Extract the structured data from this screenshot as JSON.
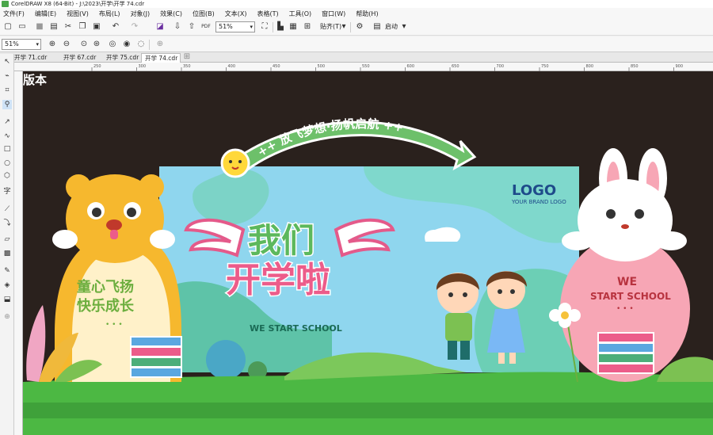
{
  "window": {
    "title": "CorelDRAW X8 (64-Bit) - J:\\2023\\开学\\开学 74.cdr"
  },
  "menu": [
    "文件(F)",
    "编辑(E)",
    "视图(V)",
    "布局(L)",
    "对象(J)",
    "效果(C)",
    "位图(B)",
    "文本(X)",
    "表格(T)",
    "工具(O)",
    "窗口(W)",
    "帮助(H)"
  ],
  "toolbar": {
    "zoom_value": "51%",
    "snap_label": "贴齐(T)",
    "launch_label": "启动",
    "pdf_label": "PDF"
  },
  "propbar": {
    "zoom_value": "51%"
  },
  "tabs": [
    "开学 71.cdr",
    "开学 67.cdr",
    "开学 75.cdr",
    "开学 74.cdr"
  ],
  "active_tab": "开学 74.cdr",
  "ruler": {
    "ticks": [
      "250",
      "300",
      "350",
      "400",
      "450",
      "500",
      "550",
      "600",
      "650",
      "700",
      "750",
      "800",
      "850",
      "900"
    ]
  },
  "design": {
    "corner_label": "版本",
    "arc_text": "++ 放飞梦想·扬帆启航 ++",
    "logo": "LOGO",
    "logo_sub": "YOUR BRAND LOGO",
    "headline_1": "我们",
    "headline_2": "开学啦",
    "slogan": "WE START SCHOOL",
    "left_text_1": "童心飞扬",
    "left_text_2": "快乐成长",
    "left_dots": "• • •",
    "right_text_1": "WE",
    "right_text_2": "START SCHOOL",
    "right_dots": "• • •"
  },
  "colors": {
    "canvas_bg": "#2a211d",
    "board": "#8fd6ee",
    "grass": "#4cb843",
    "bear": "#f6b82e",
    "rabbit_body": "#f7a6b5",
    "arc": "#6dc06a",
    "headline_green": "#5cb85c",
    "headline_pink": "#ec5c8a"
  }
}
